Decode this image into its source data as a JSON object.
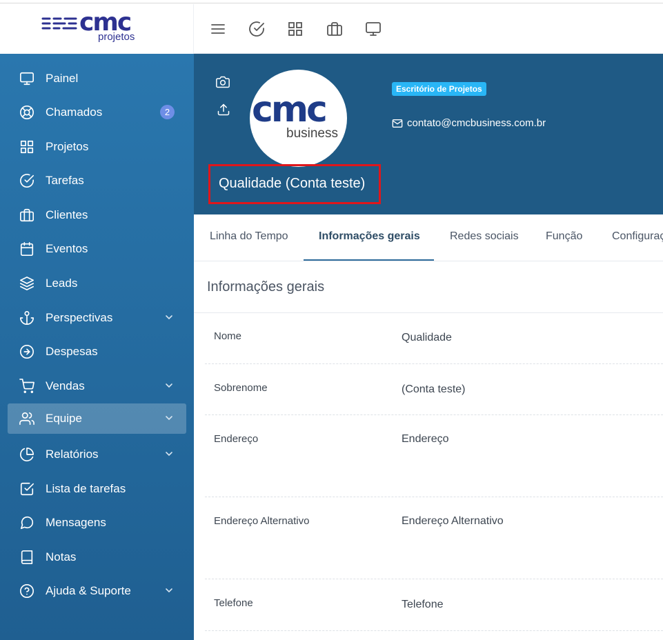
{
  "logo": {
    "word": "cmc",
    "sub": "projetos"
  },
  "sidebar": {
    "items": [
      {
        "label": "Painel",
        "icon": "monitor-icon"
      },
      {
        "label": "Chamados",
        "icon": "lifebuoy-icon",
        "badge": "2"
      },
      {
        "label": "Projetos",
        "icon": "grid-icon"
      },
      {
        "label": "Tarefas",
        "icon": "check-circle-icon"
      },
      {
        "label": "Clientes",
        "icon": "briefcase-icon"
      },
      {
        "label": "Eventos",
        "icon": "calendar-icon"
      },
      {
        "label": "Leads",
        "icon": "layers-icon"
      },
      {
        "label": "Perspectivas",
        "icon": "anchor-icon",
        "chevron": true
      },
      {
        "label": "Despesas",
        "icon": "arrow-right-circle-icon"
      },
      {
        "label": "Vendas",
        "icon": "cart-icon",
        "chevron": true
      },
      {
        "label": "Equipe",
        "icon": "users-icon",
        "chevron": true,
        "active": true
      },
      {
        "label": "Relatórios",
        "icon": "pie-chart-icon",
        "chevron": true
      },
      {
        "label": "Lista de tarefas",
        "icon": "check-square-icon"
      },
      {
        "label": "Mensagens",
        "icon": "message-circle-icon"
      },
      {
        "label": "Notas",
        "icon": "book-icon"
      },
      {
        "label": "Ajuda & Suporte",
        "icon": "help-circle-icon",
        "chevron": true
      }
    ]
  },
  "topbar": {
    "icons": [
      "menu-icon",
      "check-circle-icon",
      "grid-icon",
      "briefcase-icon",
      "monitor-icon"
    ]
  },
  "profile": {
    "avatar_word": "cmc",
    "avatar_sub": "business",
    "role": "Escritório de Projetos",
    "email": "contato@cmcbusiness.com.br",
    "name": "Qualidade (Conta teste)"
  },
  "tabs": [
    "Linha do Tempo",
    "Informações gerais",
    "Redes sociais",
    "Função",
    "Configurações"
  ],
  "info": {
    "title": "Informações gerais",
    "rows": [
      {
        "label": "Nome",
        "value": "Qualidade"
      },
      {
        "label": "Sobrenome",
        "value": "(Conta teste)"
      },
      {
        "label": "Endereço",
        "value": "Endereço"
      },
      {
        "label": "Endereço Alternativo",
        "value": "Endereço Alternativo"
      },
      {
        "label": "Telefone",
        "value": "Telefone"
      }
    ]
  },
  "colors": {
    "sidebar": "#2a77ae",
    "banner": "#1f5a85",
    "badge": "#29b6f6",
    "highlight": "#e0161b"
  }
}
